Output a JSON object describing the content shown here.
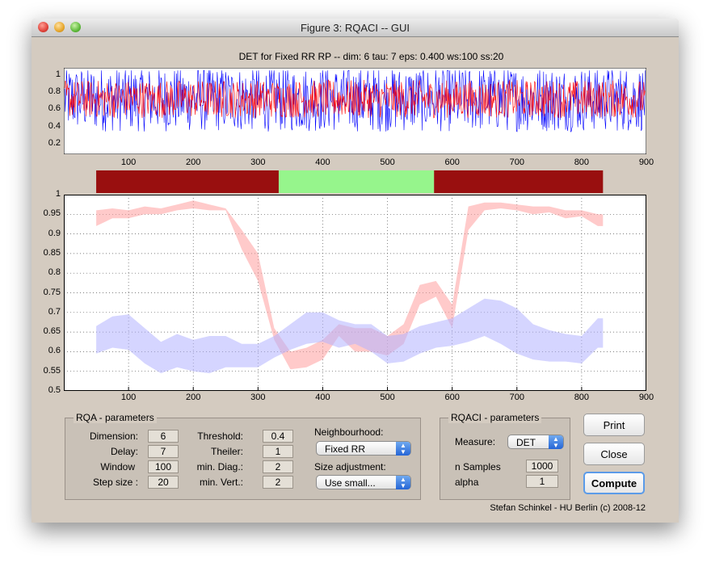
{
  "window": {
    "title": "Figure 3: RQACI -- GUI"
  },
  "top_plot": {
    "title": "DET for Fixed RR RP -- dim: 6 tau: 7 eps: 0.400 ws:100 ss:20",
    "yticks": [
      "1",
      "0.8",
      "0.6",
      "0.4",
      "0.2"
    ],
    "xticks": [
      "100",
      "200",
      "300",
      "400",
      "500",
      "600",
      "700",
      "800",
      "900"
    ],
    "colors": {
      "series1": "#0000ff",
      "series2": "#ff0000"
    }
  },
  "segments": [
    {
      "from": 50,
      "to": 332,
      "color": "#990f0f"
    },
    {
      "from": 332,
      "to": 572,
      "color": "#96f58c"
    },
    {
      "from": 572,
      "to": 833,
      "color": "#990f0f"
    }
  ],
  "main_plot": {
    "yticks": [
      "1",
      "0.95",
      "0.9",
      "0.85",
      "0.8",
      "0.75",
      "0.7",
      "0.65",
      "0.6",
      "0.55",
      "0.5"
    ],
    "xticks": [
      "100",
      "200",
      "300",
      "400",
      "500",
      "600",
      "700",
      "800",
      "900"
    ],
    "colors": {
      "red_band": "#ff9e9e",
      "blue_band": "#b3b3ff"
    }
  },
  "chart_data": {
    "type": "area",
    "x": [
      50,
      75,
      100,
      125,
      150,
      175,
      200,
      225,
      250,
      275,
      300,
      325,
      350,
      375,
      400,
      425,
      450,
      475,
      500,
      525,
      550,
      575,
      600,
      625,
      650,
      675,
      700,
      725,
      750,
      775,
      800,
      825,
      833
    ],
    "xlim": [
      0,
      900
    ],
    "ylim": [
      0.5,
      1
    ],
    "grid": true,
    "series": [
      {
        "lower": [
          0.92,
          0.94,
          0.94,
          0.95,
          0.95,
          0.96,
          0.965,
          0.96,
          0.96,
          0.86,
          0.78,
          0.63,
          0.555,
          0.56,
          0.58,
          0.64,
          0.6,
          0.6,
          0.59,
          0.62,
          0.72,
          0.74,
          0.66,
          0.91,
          0.96,
          0.965,
          0.96,
          0.95,
          0.955,
          0.94,
          0.945,
          0.92,
          0.92
        ],
        "upper": [
          0.96,
          0.965,
          0.96,
          0.97,
          0.965,
          0.975,
          0.985,
          0.975,
          0.965,
          0.91,
          0.85,
          0.66,
          0.6,
          0.61,
          0.63,
          0.67,
          0.66,
          0.66,
          0.64,
          0.67,
          0.77,
          0.78,
          0.72,
          0.97,
          0.98,
          0.98,
          0.975,
          0.97,
          0.97,
          0.96,
          0.96,
          0.95,
          0.95
        ]
      },
      {
        "lower": [
          0.595,
          0.61,
          0.605,
          0.57,
          0.545,
          0.56,
          0.55,
          0.545,
          0.56,
          0.56,
          0.56,
          0.585,
          0.605,
          0.62,
          0.625,
          0.61,
          0.62,
          0.6,
          0.57,
          0.575,
          0.595,
          0.61,
          0.615,
          0.625,
          0.64,
          0.62,
          0.595,
          0.58,
          0.575,
          0.575,
          0.57,
          0.61,
          0.61
        ],
        "upper": [
          0.665,
          0.69,
          0.695,
          0.66,
          0.625,
          0.645,
          0.63,
          0.64,
          0.64,
          0.62,
          0.62,
          0.64,
          0.67,
          0.7,
          0.7,
          0.68,
          0.67,
          0.67,
          0.64,
          0.645,
          0.665,
          0.675,
          0.685,
          0.71,
          0.735,
          0.73,
          0.71,
          0.67,
          0.655,
          0.645,
          0.64,
          0.685,
          0.685
        ]
      }
    ]
  },
  "rqa": {
    "title": "RQA - parameters",
    "dimension_label": "Dimension:",
    "dimension": "6",
    "delay_label": "Delay:",
    "delay": "7",
    "window_label": "Window",
    "window": "100",
    "step_label": "Step size :",
    "step": "20",
    "threshold_label": "Threshold:",
    "threshold": "0.4",
    "theiler_label": "Theiler:",
    "theiler": "1",
    "mindiag_label": "min. Diag.:",
    "mindiag": "2",
    "minvert_label": "min. Vert.:",
    "minvert": "2",
    "neigh_label": "Neighbourhood:",
    "neigh": "Fixed RR",
    "size_label": "Size adjustment:",
    "size": "Use small..."
  },
  "rqaci": {
    "title": "RQACI - parameters",
    "measure_label": "Measure:",
    "measure": "DET",
    "nsamples_label": "n Samples",
    "nsamples": "1000",
    "alpha_label": "alpha",
    "alpha": "1"
  },
  "buttons": {
    "print": "Print",
    "close": "Close",
    "compute": "Compute"
  },
  "footer": "Stefan Schinkel - HU Berlin (c) 2008-12"
}
